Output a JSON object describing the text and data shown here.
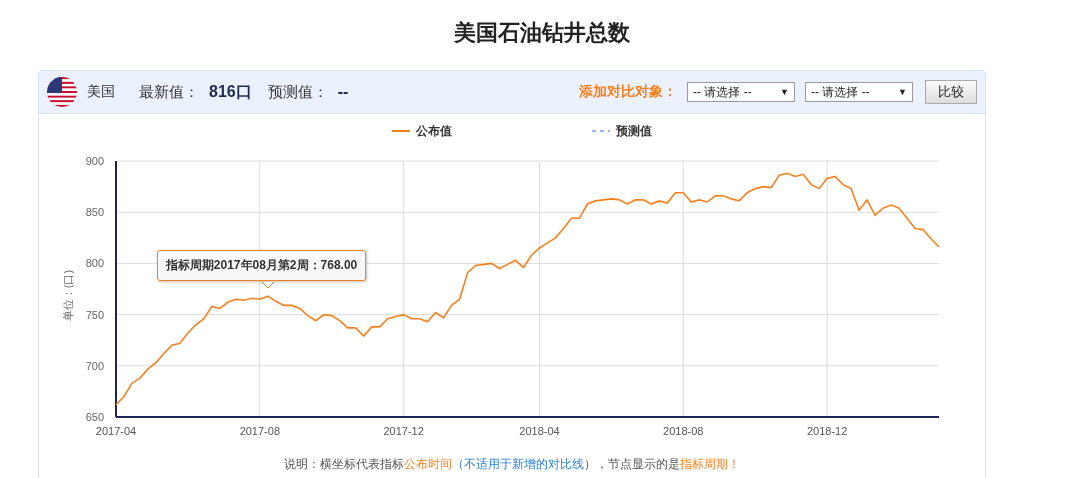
{
  "page_title": "美国石油钻井总数",
  "header": {
    "country": "美国",
    "latest_label": "最新值：",
    "latest_value": "816口",
    "forecast_label": "预测值：",
    "forecast_value": "--",
    "compare_label": "添加对比对象：",
    "selects": [
      {
        "value": "-- 请选择 --",
        "caret": "▼"
      },
      {
        "value": "-- 请选择 --",
        "caret": "▼"
      }
    ],
    "compare_button": "比较"
  },
  "chart": {
    "forecast_legend": {
      "name": "预测值",
      "color": "#8fb8e8"
    },
    "chart_data": {
      "type": "line",
      "ylabel": "单位：(口)",
      "grid": true,
      "categories": [
        "2017-04",
        null,
        null,
        null,
        null,
        null,
        null,
        null,
        null,
        null,
        null,
        null,
        null,
        null,
        null,
        null,
        null,
        null,
        "2017-08",
        null,
        null,
        null,
        null,
        null,
        null,
        null,
        null,
        null,
        null,
        null,
        null,
        null,
        null,
        null,
        null,
        null,
        "2017-12",
        null,
        null,
        null,
        null,
        null,
        null,
        null,
        null,
        null,
        null,
        null,
        null,
        null,
        null,
        null,
        null,
        "2018-04",
        null,
        null,
        null,
        null,
        null,
        null,
        null,
        null,
        null,
        null,
        null,
        null,
        null,
        null,
        null,
        null,
        null,
        "2018-08",
        null,
        null,
        null,
        null,
        null,
        null,
        null,
        null,
        null,
        null,
        null,
        null,
        null,
        null,
        null,
        null,
        null,
        "2018-12",
        null,
        null,
        null,
        null,
        null,
        null,
        null,
        null,
        null,
        null,
        null,
        null,
        null,
        null
      ],
      "series": [
        {
          "name": "公布值",
          "color": "#f7801e",
          "values": [
            662,
            670,
            683,
            688,
            697,
            703,
            712,
            720,
            722,
            732,
            740,
            746,
            758,
            756,
            762,
            765,
            764,
            766,
            765,
            768,
            763,
            759,
            759,
            756,
            749,
            744,
            750,
            749,
            744,
            737,
            737,
            729,
            738,
            738,
            746,
            748,
            750,
            746,
            746,
            743,
            752,
            747,
            759,
            765,
            791,
            798,
            799,
            800,
            795,
            799,
            803,
            796,
            808,
            815,
            820,
            825,
            834,
            844,
            844,
            858,
            861,
            862,
            863,
            862,
            858,
            862,
            862,
            858,
            861,
            859,
            869,
            869,
            860,
            862,
            860,
            866,
            866,
            863,
            861,
            869,
            873,
            875,
            874,
            886,
            888,
            885,
            887,
            877,
            873,
            883,
            885,
            877,
            873,
            852,
            862,
            847,
            854,
            857,
            854,
            844,
            834,
            833,
            824,
            816
          ]
        }
      ],
      "ylim": [
        650,
        900
      ],
      "yticks": [
        650,
        700,
        750,
        800,
        850,
        900
      ],
      "annotations": [
        {
          "y": 768,
          "text": "指标周期2017年08月第2周：768.00"
        }
      ]
    }
  },
  "note": [
    {
      "kind": "plain",
      "text": "说明：横坐标代表指标"
    },
    {
      "kind": "highlight",
      "text": "公布时间"
    },
    {
      "kind": "link",
      "text": "（不适用于新增的对比线"
    },
    {
      "kind": "plain",
      "text": "），节点显示的是"
    },
    {
      "kind": "highlight",
      "text": "指标周期！"
    }
  ]
}
